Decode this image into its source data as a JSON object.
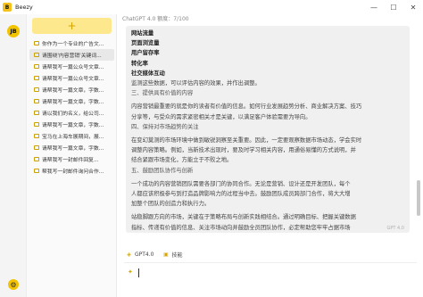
{
  "window": {
    "title": "Beezy",
    "logo_text": "B",
    "minimize": "—",
    "maximize": "☐",
    "close": "✕"
  },
  "rail": {
    "logo_text": "JB",
    "settings_icon": "gear-icon"
  },
  "sidebar": {
    "new_chat_label": "+",
    "items": [
      {
        "label": "你作为一个专业的广告文..."
      },
      {
        "label": "请围绕'内容营销'关键词..."
      },
      {
        "label": "请帮我写一篇公众号文章..."
      },
      {
        "label": "请帮我写一篇公众号文章..."
      },
      {
        "label": "请帮我写一篇文章，字数..."
      },
      {
        "label": "请帮我写一篇文章，字数..."
      },
      {
        "label": "请以我们的名义，给公司..."
      },
      {
        "label": "请帮我写一篇文章，字数..."
      },
      {
        "label": "宝马在上海车展期间，展..."
      },
      {
        "label": "请帮我写一篇文章，字数..."
      },
      {
        "label": "请帮我写一封邮件回复..."
      },
      {
        "label": "帮我写一封邮件询问合作..."
      }
    ],
    "active_index": 1
  },
  "main": {
    "model_info": "ChatGPT 4.0  额度：7/100",
    "message_lines": [
      {
        "text": "网站流量",
        "style": "bold"
      },
      {
        "text": "页面浏览量",
        "style": "bold"
      },
      {
        "text": "用户留存率",
        "style": "bold"
      },
      {
        "text": "转化率",
        "style": "bold"
      },
      {
        "text": "社交媒体互动",
        "style": "bold"
      },
      {
        "text": "监测这些数据，可以评估内容的效果，并作出调整。",
        "style": "normal"
      },
      {
        "text": "三、提供具有价值的内容",
        "style": "heading"
      },
      {
        "text": "内容营销最重要的就是你的读者有价值的信息。如何行业发展趋势分析、商业解决方案、技巧",
        "style": "gap"
      },
      {
        "text": "分享等，与受众的需求紧密相关才是关键，以满足客户体验需要为导向。",
        "style": "normal"
      },
      {
        "text": "四、保持对市场趋势的关注",
        "style": "heading"
      },
      {
        "text": "在变幻莫测的市场环境中做到敏锐洞察至关重要。因此，一定要观察数据市场动态，学会实时",
        "style": "gap"
      },
      {
        "text": "调整内容策略。例如，当新技术出现时，要及时学习相关内容，用通俗易懂的方式说明，并",
        "style": "normal"
      },
      {
        "text": "结合紧跟市场变化，方能立于不败之地。",
        "style": "normal"
      },
      {
        "text": "五、鼓励团队协作与创新",
        "style": "heading"
      },
      {
        "text": "一个成功的内容营销团队需要各部门的协同合作。无论是营销、设计还是开发团队，每个",
        "style": "gap"
      },
      {
        "text": "人都应该积极参与到打造品牌影响力的过程当中去。鼓励团队成员跨部门合作，将大大增",
        "style": "normal"
      },
      {
        "text": "加整个团队的创造力和执行力。",
        "style": "normal"
      },
      {
        "text": "站稳脚跟方向的市场，关键在于策略布局与创新实践相结合。通过明确目标、把握关键数据",
        "style": "gap"
      },
      {
        "text": "指标、传递有价值的信息、关注市场动向并鼓励全员团队协作，必定帮助您牢牢占据市场",
        "style": "normal"
      },
      {
        "text": "先机！",
        "style": "normal"
      }
    ],
    "message_footer": "GPT 4.0",
    "toolbar": {
      "model_label": "GPT4.0",
      "skills_label": "技能"
    },
    "input": {
      "value": "",
      "placeholder": ""
    }
  },
  "colors": {
    "accent": "#f2c300",
    "new_chat_bg": "#fde88e",
    "message_bg": "#f0f0f0"
  }
}
